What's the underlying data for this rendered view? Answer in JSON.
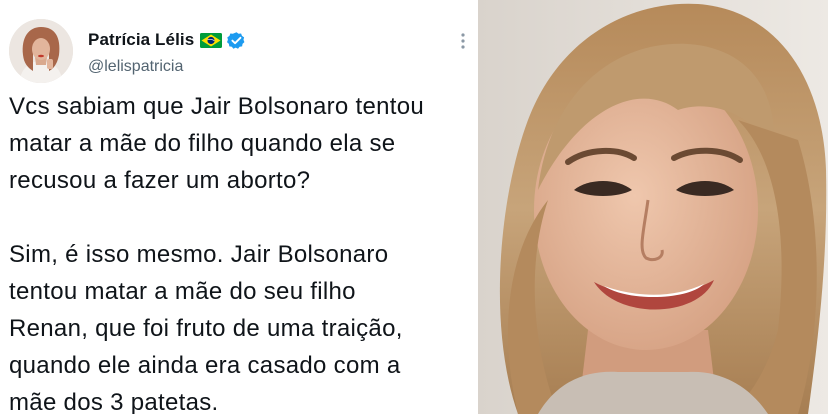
{
  "tweet": {
    "display_name": "Patrícia Lélis",
    "handle": "@lelispatricia",
    "text": "Vcs sabiam que Jair Bolsonaro tentou\nmatar a mãe do filho quando ela se\nrecusou a fazer um aborto?\n\nSim, é isso mesmo. Jair Bolsonaro\ntentou matar a mãe do seu filho\nRenan, que foi fruto de uma traição,\nquando ele ainda era casado com a\nmãe dos 3 patetas.",
    "flag_icon": "brazil-flag-icon",
    "verified_icon": "verified-badge-icon",
    "more_icon": "more-options-icon"
  },
  "colors": {
    "verified": "#1d9bf0",
    "text": "#0f1419",
    "secondary_text": "#536471",
    "flag_green": "#009c3b",
    "flag_yellow": "#ffdf00",
    "flag_blue": "#002776"
  }
}
